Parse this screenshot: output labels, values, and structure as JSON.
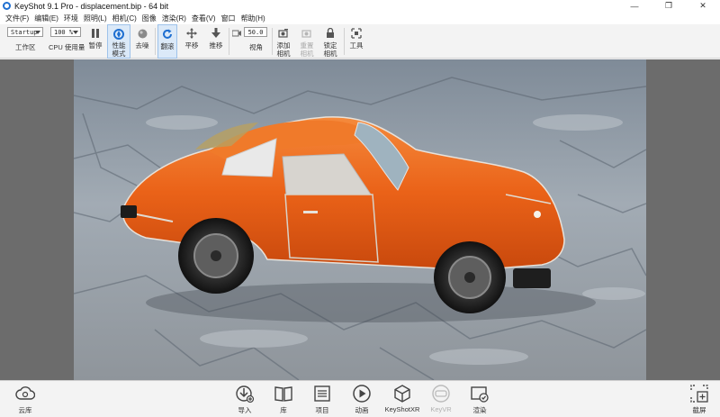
{
  "window": {
    "title": "KeyShot 9.1 Pro  - displacement.bip  - 64 bit",
    "minimize": "—",
    "restore": "❐",
    "close": "✕"
  },
  "menu": [
    "文件(F)",
    "编辑(E)",
    "环境",
    "照明(L)",
    "相机(C)",
    "图像",
    "渲染(R)",
    "查看(V)",
    "窗口",
    "帮助(H)"
  ],
  "ribbon": {
    "workspace_value": "Startup",
    "workspace_label": "工作区",
    "cpu_value": "100 %",
    "cpu_label": "CPU 使用量",
    "pause": "暂停",
    "perf_mode": "性能\n模式",
    "denoise": "去噪",
    "tumble": "翻滚",
    "pan": "平移",
    "dolly": "推移",
    "fov_value": "50.0",
    "fov_label": "视角",
    "add_camera": "添加\n相机",
    "reset_camera": "重置\n相机",
    "lock_camera": "锁定\n相机",
    "tools": "工具"
  },
  "bottom": {
    "cloud": "云库",
    "import": "导入",
    "library": "库",
    "project": "项目",
    "animation": "动画",
    "keyshotxr": "KeyShotXR",
    "keyvr": "KeyVR",
    "render": "渲染",
    "screenshot": "截屏"
  },
  "colors": {
    "accent": "#1e6fd1",
    "car_orange": "#ef6a1e",
    "active_bg": "#dbe9f8"
  }
}
